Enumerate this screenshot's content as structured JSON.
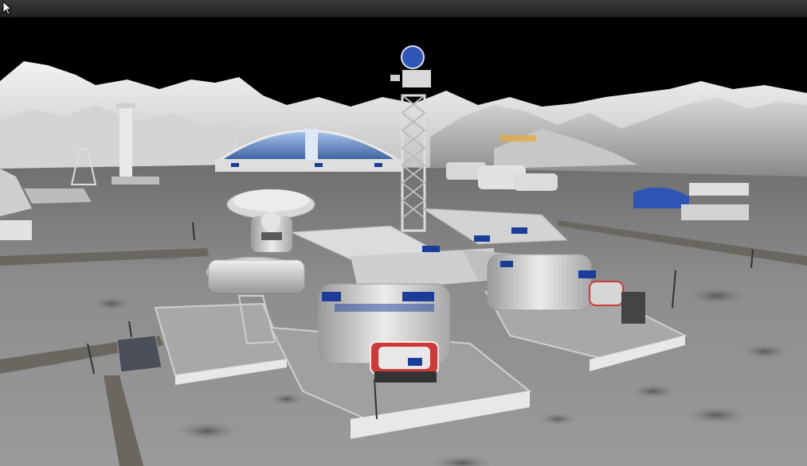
{
  "window": {
    "title": "",
    "cursor_icon": "arrow-cursor-icon"
  },
  "scene": {
    "type": "3d-game-viewport",
    "setting": "lunar-base",
    "sky_color": "#000000",
    "terrain_color": "#8d8d8d",
    "mountain_color": "#e6e6e6",
    "accent_blue": "#1c3c9a",
    "dome_glass": "#6f9ad6",
    "billboard_color": "#e7a93c",
    "billboard_text": ""
  }
}
